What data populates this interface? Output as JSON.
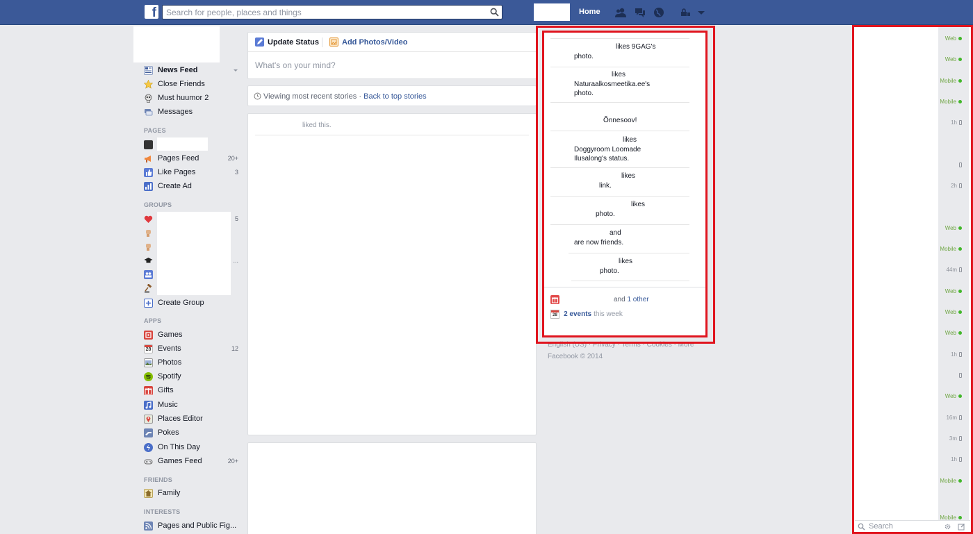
{
  "topbar": {
    "logo": "f",
    "search_placeholder": "Search for people, places and things",
    "home_label": "Home"
  },
  "left_nav": {
    "favorites": [
      {
        "label": "News Feed",
        "icon": "news-feed-icon"
      },
      {
        "label": "Close Friends",
        "icon": "star-icon"
      },
      {
        "label": "Must huumor 2",
        "icon": "skull-icon"
      },
      {
        "label": "Messages",
        "icon": "messages-icon"
      }
    ],
    "pages_title": "PAGES",
    "pages": [
      {
        "label": "Pages Feed",
        "count": "20+"
      },
      {
        "label": "Like Pages",
        "count": "3"
      },
      {
        "label": "Create Ad",
        "count": ""
      }
    ],
    "groups_title": "GROUPS",
    "groups_count": "5",
    "groups_ellipsis": "...",
    "create_group": "Create Group",
    "apps_title": "APPS",
    "apps": [
      {
        "label": "Games",
        "count": ""
      },
      {
        "label": "Events",
        "count": "12"
      },
      {
        "label": "Photos",
        "count": ""
      },
      {
        "label": "Spotify",
        "count": ""
      },
      {
        "label": "Gifts",
        "count": ""
      },
      {
        "label": "Music",
        "count": ""
      },
      {
        "label": "Places Editor",
        "count": ""
      },
      {
        "label": "Pokes",
        "count": ""
      },
      {
        "label": "On This Day",
        "count": ""
      },
      {
        "label": "Games Feed",
        "count": "20+"
      }
    ],
    "friends_title": "FRIENDS",
    "friends": [
      {
        "label": "Family"
      }
    ],
    "interests_title": "INTERESTS",
    "interests": [
      {
        "label": "Pages and Public Fig..."
      }
    ]
  },
  "composer": {
    "update_status": "Update Status",
    "add_photos": "Add Photos/Video",
    "placeholder": "What's on your mind?"
  },
  "viewing": {
    "text": "Viewing most recent stories",
    "separator": "·",
    "link": "Back to top stories"
  },
  "story": {
    "liked_text": "liked this."
  },
  "ticker": {
    "items": [
      {
        "l1": "likes 9GAG's",
        "l2": "photo.",
        "l3": ""
      },
      {
        "l1": "likes",
        "l2": "Naturaalkosmeetika.ee's",
        "l3": "photo."
      },
      {
        "l1": "Õnnesoov!",
        "l2": "",
        "l3": ""
      },
      {
        "l1": "likes",
        "l2": "Doggyroom Loomade",
        "l3": "Ilusalong's status."
      },
      {
        "l1": "likes",
        "l2": "link.",
        "l3": ""
      },
      {
        "l1": "likes",
        "l2": "photo.",
        "l3": ""
      },
      {
        "l1": "and",
        "l2": "are now friends.",
        "l3": ""
      },
      {
        "l1": "likes",
        "l2": "photo.",
        "l3": ""
      }
    ],
    "birthday_and": "and",
    "birthday_other": "1 other",
    "events_link": "2 events",
    "events_suffix": "this week",
    "calendar_day": "28"
  },
  "footer": {
    "links": "English (US) · Privacy · Terms · Cookies · More",
    "copyright": "Facebook © 2014"
  },
  "chat": {
    "statuses": [
      "Web",
      "Web",
      "Mobile",
      "Mobile",
      "1h",
      "",
      "2h",
      "Web",
      "Mobile",
      "44m",
      "Web",
      "Web",
      "Web",
      "1h",
      "",
      "Web",
      "16m",
      "3m",
      "1h",
      "Mobile",
      "Mobile"
    ],
    "search_placeholder": "Search"
  },
  "colors": {
    "brand_blue": "#3b5998",
    "link_blue": "#365899",
    "online_green": "#42b72a",
    "highlight_red": "#e0141e"
  }
}
